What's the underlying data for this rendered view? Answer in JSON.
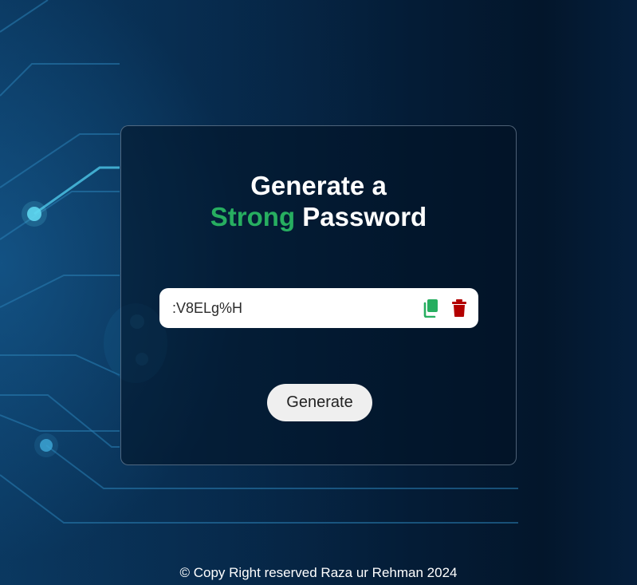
{
  "colors": {
    "accent_green": "#27ae60",
    "delete_red": "#b30000",
    "copy_green": "#27ae60"
  },
  "card": {
    "title_line1": "Generate a",
    "title_highlight": "Strong",
    "title_rest": "Password"
  },
  "password": {
    "value": ":V8ELg%H",
    "copy_icon": "copy-icon",
    "delete_icon": "trash-icon"
  },
  "generate_label": "Generate",
  "footer": {
    "text": "© Copy Right reserved Raza ur Rehman 2024"
  }
}
